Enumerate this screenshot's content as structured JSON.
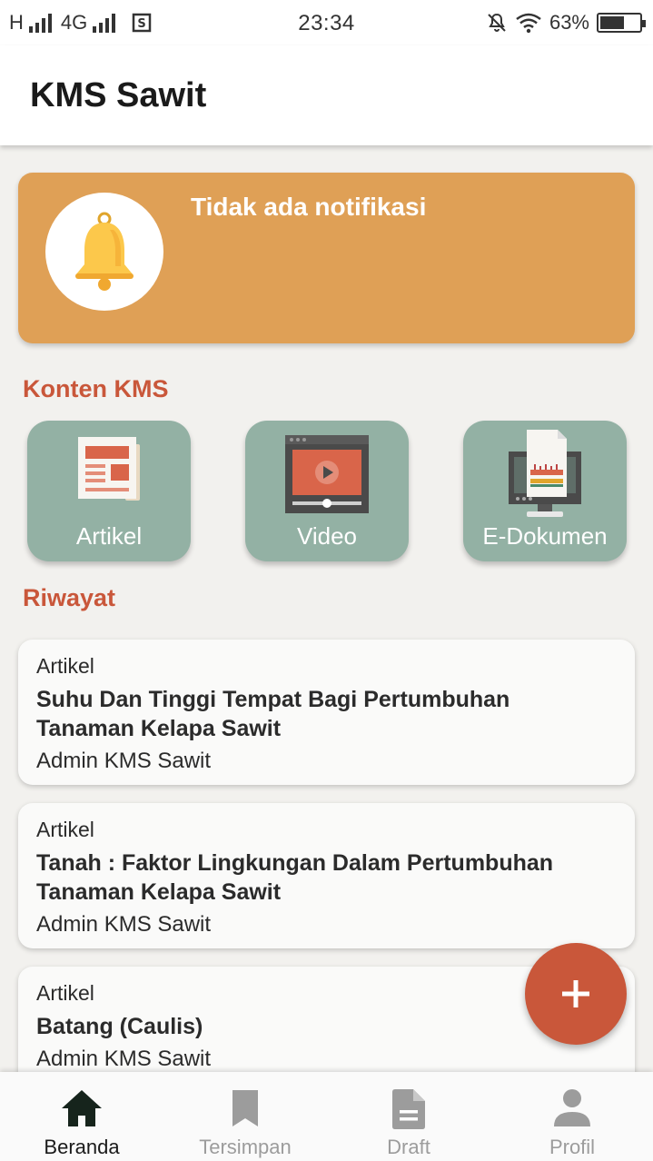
{
  "status_bar": {
    "network_left": "H",
    "network_type": "4G",
    "time": "23:34",
    "battery": "63%",
    "battery_level": 0.63
  },
  "app_bar": {
    "title": "KMS Sawit"
  },
  "notification": {
    "text": "Tidak ada notifikasi",
    "icon": "bell-icon"
  },
  "sections": {
    "content": "Konten KMS",
    "history": "Riwayat"
  },
  "content_tiles": [
    {
      "label": "Artikel",
      "icon": "article-icon"
    },
    {
      "label": "Video",
      "icon": "video-icon"
    },
    {
      "label": "E-Dokumen",
      "icon": "e-document-icon"
    }
  ],
  "history": [
    {
      "type": "Artikel",
      "title": "Suhu Dan Tinggi Tempat Bagi Pertumbuhan Tanaman Kelapa Sawit",
      "author": "Admin KMS Sawit"
    },
    {
      "type": "Artikel",
      "title": "Tanah : Faktor Lingkungan Dalam Pertumbuhan Tanaman Kelapa Sawit",
      "author": "Admin KMS Sawit"
    },
    {
      "type": "Artikel",
      "title": "Batang (Caulis)",
      "author": "Admin KMS Sawit"
    }
  ],
  "fab": {
    "icon": "plus-icon"
  },
  "bottom_nav": [
    {
      "label": "Beranda",
      "icon": "home-icon",
      "active": true
    },
    {
      "label": "Tersimpan",
      "icon": "bookmark-icon",
      "active": false
    },
    {
      "label": "Draft",
      "icon": "document-icon",
      "active": false
    },
    {
      "label": "Profil",
      "icon": "person-icon",
      "active": false
    }
  ],
  "colors": {
    "accent": "#c9573a",
    "notification_bg": "#dfa056",
    "tile_bg": "#93b1a4",
    "page_bg": "#f2f1ee"
  }
}
